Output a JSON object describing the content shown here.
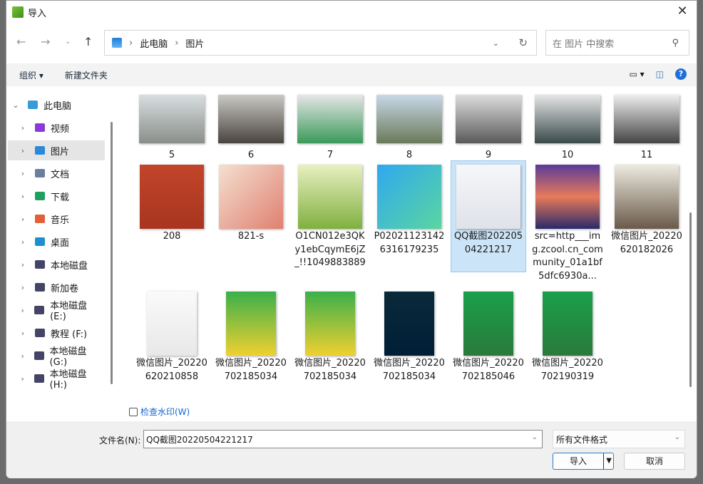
{
  "window": {
    "title": "导入"
  },
  "nav": {
    "path": [
      "此电脑",
      "图片"
    ],
    "search_placeholder": "在 图片 中搜索"
  },
  "toolbar": {
    "organize": "组织 ▾",
    "new_folder": "新建文件夹",
    "help": "?"
  },
  "sidebar": {
    "items": [
      {
        "label": "此电脑",
        "color": "#3a9ad9"
      },
      {
        "label": "视频",
        "color": "#8a3ad9"
      },
      {
        "label": "图片",
        "color": "#2a8ad9",
        "selected": true
      },
      {
        "label": "文档",
        "color": "#6a7ea0"
      },
      {
        "label": "下载",
        "color": "#20a060"
      },
      {
        "label": "音乐",
        "color": "#e0603a"
      },
      {
        "label": "桌面",
        "color": "#1e90d0"
      },
      {
        "label": "本地磁盘",
        "color": "#446"
      },
      {
        "label": "新加卷",
        "color": "#446"
      },
      {
        "label": "本地磁盘 (E:)",
        "color": "#446"
      },
      {
        "label": "教程 (F:)",
        "color": "#446"
      },
      {
        "label": "本地磁盘 (G:)",
        "color": "#446"
      },
      {
        "label": "本地磁盘 (H:)",
        "color": "#446"
      }
    ]
  },
  "files": [
    {
      "name": "5",
      "bg": "linear-gradient(#d8dde0,#8a8f8a)"
    },
    {
      "name": "6",
      "bg": "linear-gradient(#c9c9c4,#4a4440)"
    },
    {
      "name": "7",
      "bg": "linear-gradient(#e6e6e6,#3a9a5a)"
    },
    {
      "name": "8",
      "bg": "linear-gradient(#c8d8e8,#6a7a5a)"
    },
    {
      "name": "9",
      "bg": "linear-gradient(#ddd,#5a5a5a)"
    },
    {
      "name": "10",
      "bg": "linear-gradient(#e6e6e6,#3a4a4a)"
    },
    {
      "name": "11",
      "bg": "linear-gradient(#eee,#444)"
    },
    {
      "name": "208",
      "bg": "linear-gradient(#c2452a,#a8351e)"
    },
    {
      "name": "821-s",
      "bg": "linear-gradient(135deg,#f4e0d0,#e08070)"
    },
    {
      "name": "O1CN012e3QKy1ebCqymE6jZ_!!1049883889",
      "bg": "linear-gradient(#e8f0c0,#80b040)"
    },
    {
      "name": "P020211231426316179235",
      "bg": "linear-gradient(135deg,#2fa8f0,#5ad6a0)"
    },
    {
      "name": "QQ截图20220504221217",
      "bg": "linear-gradient(#f6f7fa,#dfe2e8)",
      "selected": true
    },
    {
      "name": "src=http___img.zcool.cn_community_01a1bf5dfc6930a...",
      "bg": "linear-gradient(#5a3a9a,#e87a5a,#2a2a6a)"
    },
    {
      "name": "微信图片_20220620182026",
      "bg": "linear-gradient(#eeeae0,#6a5a4a)"
    },
    {
      "name": "微信图片_20220620210858",
      "bg": "linear-gradient(#fafafa,#e8e8e8)"
    },
    {
      "name": "微信图片_20220702185034",
      "bg": "linear-gradient(#3ab04a,#f0d030)"
    },
    {
      "name": "微信图片_20220702185034",
      "bg": "linear-gradient(#3ab04a,#f0d030)"
    },
    {
      "name": "微信图片_20220702185034",
      "bg": "linear-gradient(#0a2a3a,#001e36)"
    },
    {
      "name": "微信图片_20220702185046",
      "bg": "linear-gradient(#1aa04a,#2a7a3a)"
    },
    {
      "name": "微信图片_20220702190319",
      "bg": "linear-gradient(#1aa04a,#2a7a3a)"
    }
  ],
  "watermark": {
    "label": "检查水印(W)",
    "checked": false
  },
  "footer": {
    "filename_label": "文件名(N):",
    "filename_value": "QQ截图20220504221217",
    "filetype": "所有文件格式",
    "import": "导入",
    "cancel": "取消"
  }
}
